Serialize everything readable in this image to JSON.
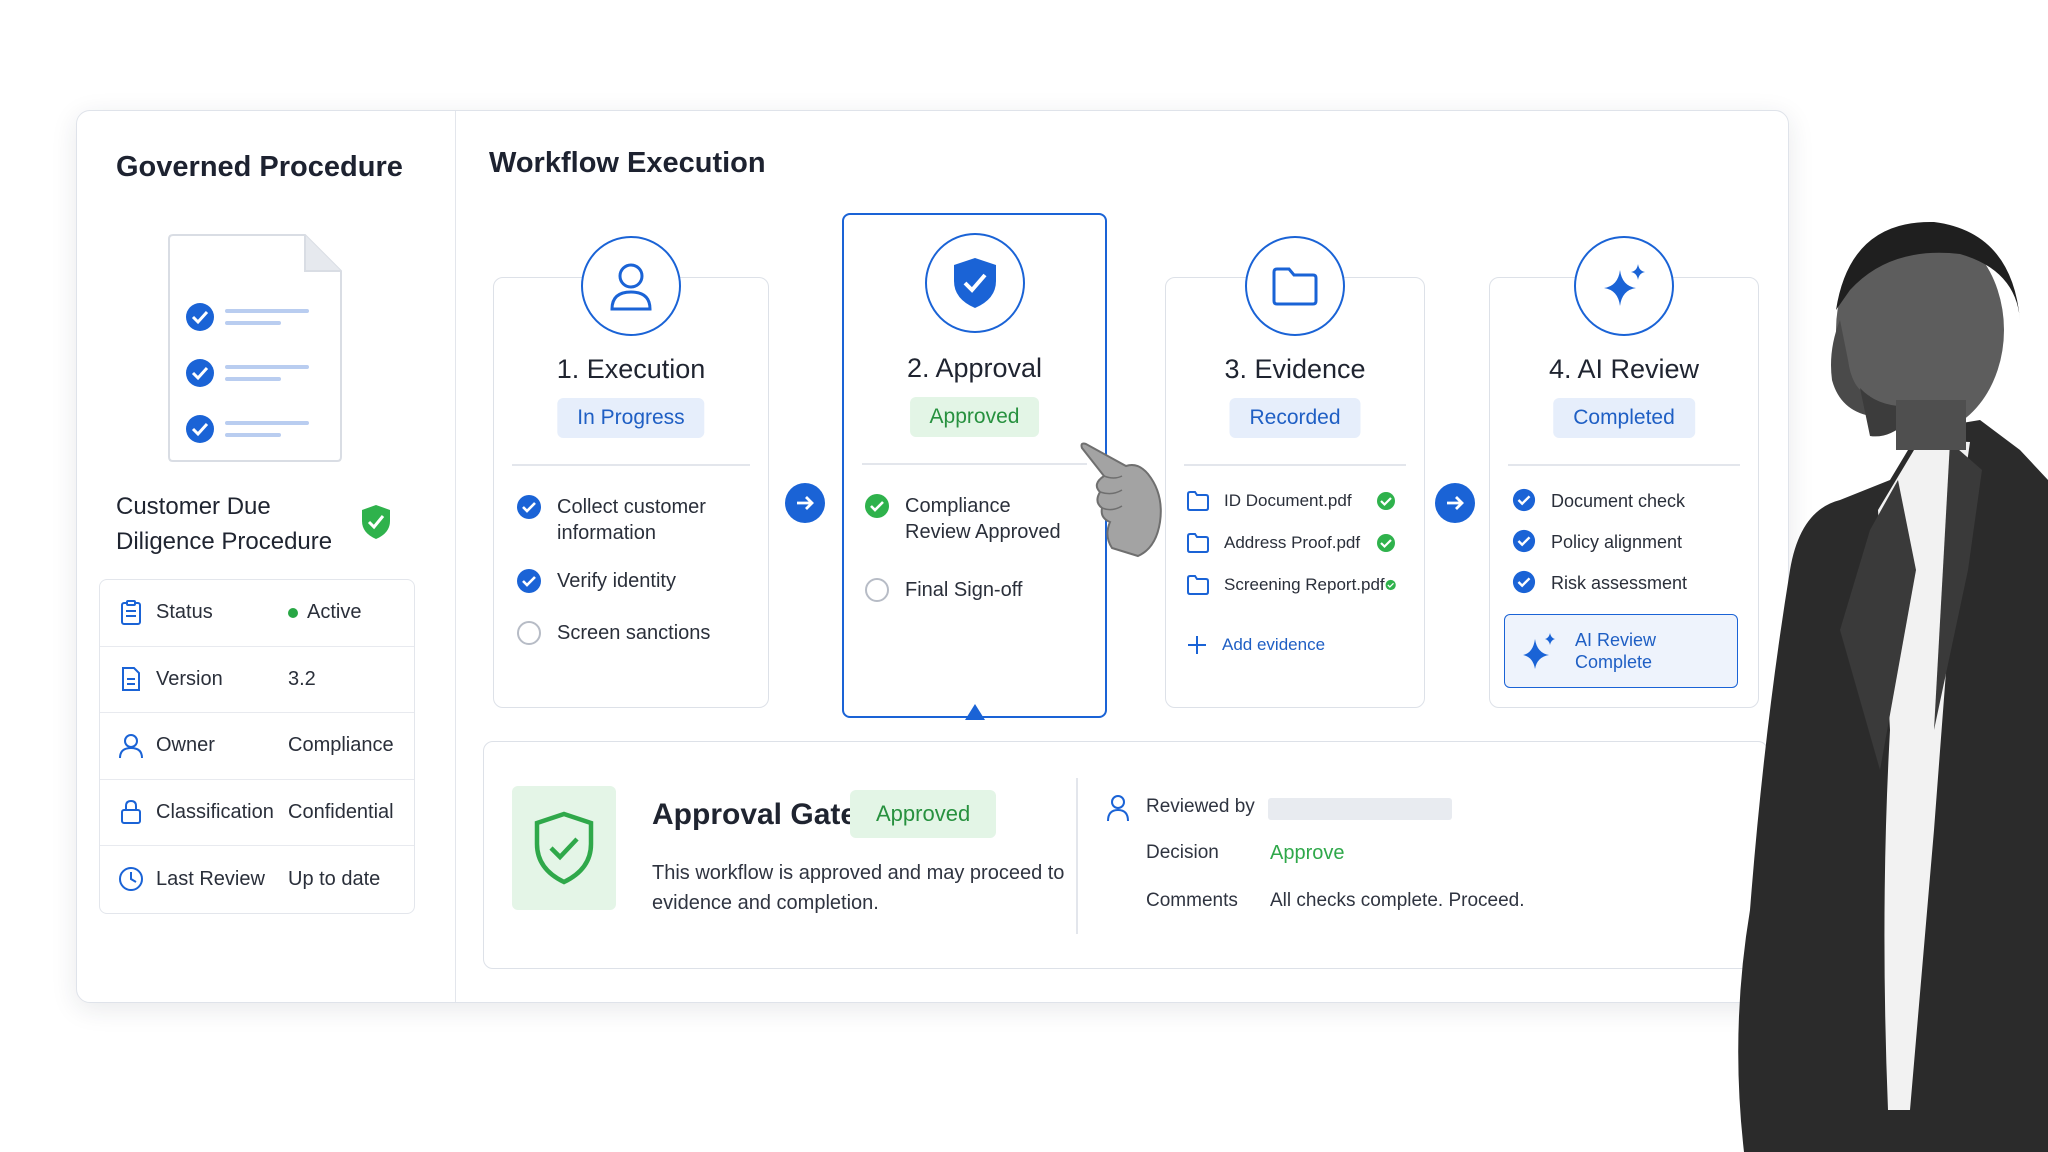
{
  "left_panel": {
    "title": "Governed Procedure",
    "procedure_name": "Customer Due Diligence Procedure",
    "meta": [
      {
        "icon": "clipboard-icon",
        "label": "Status",
        "value": "Active",
        "status_color": "#28a745"
      },
      {
        "icon": "document-icon",
        "label": "Version",
        "value": "3.2"
      },
      {
        "icon": "user-icon",
        "label": "Owner",
        "value": "Compliance"
      },
      {
        "icon": "lock-icon",
        "label": "Classification",
        "value": "Confidential"
      },
      {
        "icon": "clock-icon",
        "label": "Last Review",
        "value": "Up to date"
      }
    ]
  },
  "workflow": {
    "title": "Workflow Execution",
    "steps": [
      {
        "icon": "user-icon",
        "title": "1. Execution",
        "status": "In Progress",
        "tasks": [
          {
            "label": "Collect customer information",
            "done": true
          },
          {
            "label": "Verify identity",
            "done": true
          },
          {
            "label": "Screen sanctions",
            "done": false
          }
        ]
      },
      {
        "icon": "shield-check-icon",
        "title": "2. Approval",
        "status": "Approved",
        "tasks": [
          {
            "label": "Compliance Review Approved",
            "done": true
          },
          {
            "label": "Final Sign-off",
            "done": false
          }
        ]
      },
      {
        "icon": "folder-icon",
        "title": "3. Evidence",
        "status": "Recorded",
        "files": [
          "ID Document.pdf",
          "Address Proof.pdf",
          "Screening Report.pdf"
        ],
        "add_label": "Add evidence"
      },
      {
        "icon": "sparkle-icon",
        "title": "4. AI Review",
        "status": "Completed",
        "tasks": [
          {
            "label": "Document check",
            "done": true
          },
          {
            "label": "Policy alignment",
            "done": true
          },
          {
            "label": "Risk assessment",
            "done": true
          }
        ],
        "complete_label": "AI Review Complete"
      }
    ]
  },
  "approval_gate": {
    "title": "Approval Gate",
    "status": "Approved",
    "description": "This workflow is approved and may proceed to evidence and completion.",
    "reviewed_by_label": "Reviewed by",
    "decision_label": "Decision",
    "decision_value": "Approve",
    "comments_label": "Comments",
    "comments_value": "All checks complete. Proceed."
  },
  "colors": {
    "accent": "#1a63d6",
    "success": "#2fb24c",
    "pill_blue_bg": "#e6eefb",
    "pill_green_bg": "#e3f5e6"
  }
}
